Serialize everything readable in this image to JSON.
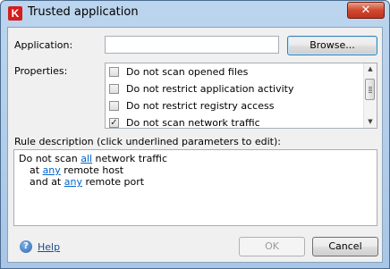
{
  "window": {
    "title": "Trusted application",
    "close_glyph": "✕",
    "logo_letter": "K",
    "logo_color": "#d41e1e"
  },
  "form": {
    "application_label": "Application:",
    "application_value": "",
    "browse_label": "Browse...",
    "properties_label": "Properties:",
    "properties": [
      {
        "label": "Do not scan opened files",
        "checked": false
      },
      {
        "label": "Do not restrict application activity",
        "checked": false
      },
      {
        "label": "Do not restrict registry access",
        "checked": false
      },
      {
        "label": "Do not scan network traffic",
        "checked": true
      }
    ],
    "rule_desc_label": "Rule description (click underlined parameters to edit):",
    "rule": {
      "l1_prefix": "Do not scan ",
      "l1_link": "all",
      "l1_suffix": " network traffic",
      "l2_prefix": "at ",
      "l2_link": "any",
      "l2_suffix": " remote host",
      "l3_prefix": "and at ",
      "l3_link": "any",
      "l3_suffix": " remote port"
    }
  },
  "footer": {
    "help_label": "Help",
    "help_icon": "question-icon",
    "ok_label": "OK",
    "cancel_label": "Cancel"
  },
  "colors": {
    "link": "#0066cc",
    "disabled_text": "#9a9a9a"
  }
}
